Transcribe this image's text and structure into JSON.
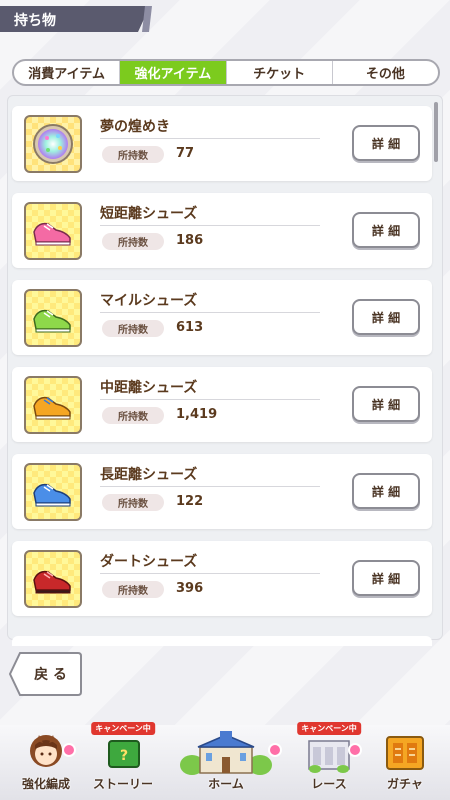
{
  "header": {
    "title": "持ち物"
  },
  "tabs": [
    {
      "label": "消費アイテム",
      "active": false
    },
    {
      "label": "強化アイテム",
      "active": true
    },
    {
      "label": "チケット",
      "active": false
    },
    {
      "label": "その他",
      "active": false
    }
  ],
  "list": {
    "qty_label": "所持数",
    "detail_label": "詳 細",
    "items": [
      {
        "name": "夢の煌めき",
        "qty": "77",
        "icon": "sparkle-orb-icon"
      },
      {
        "name": "短距離シューズ",
        "qty": "186",
        "icon": "pink-shoes-icon"
      },
      {
        "name": "マイルシューズ",
        "qty": "613",
        "icon": "green-shoes-icon"
      },
      {
        "name": "中距離シューズ",
        "qty": "1,419",
        "icon": "orange-shoes-icon"
      },
      {
        "name": "長距離シューズ",
        "qty": "122",
        "icon": "blue-shoes-icon"
      },
      {
        "name": "ダートシューズ",
        "qty": "396",
        "icon": "red-shoes-icon"
      }
    ]
  },
  "back_button": {
    "label": "戻 る"
  },
  "nav": {
    "campaign_label": "キャンペーン中",
    "items": [
      {
        "label": "強化編成"
      },
      {
        "label": "ストーリー"
      },
      {
        "label": "ホーム"
      },
      {
        "label": "レース"
      },
      {
        "label": "ガチャ"
      }
    ]
  },
  "colors": {
    "active_tab": "#7ccb1e",
    "header_bg": "#5a5a6e",
    "campaign_red": "#e0372f"
  }
}
